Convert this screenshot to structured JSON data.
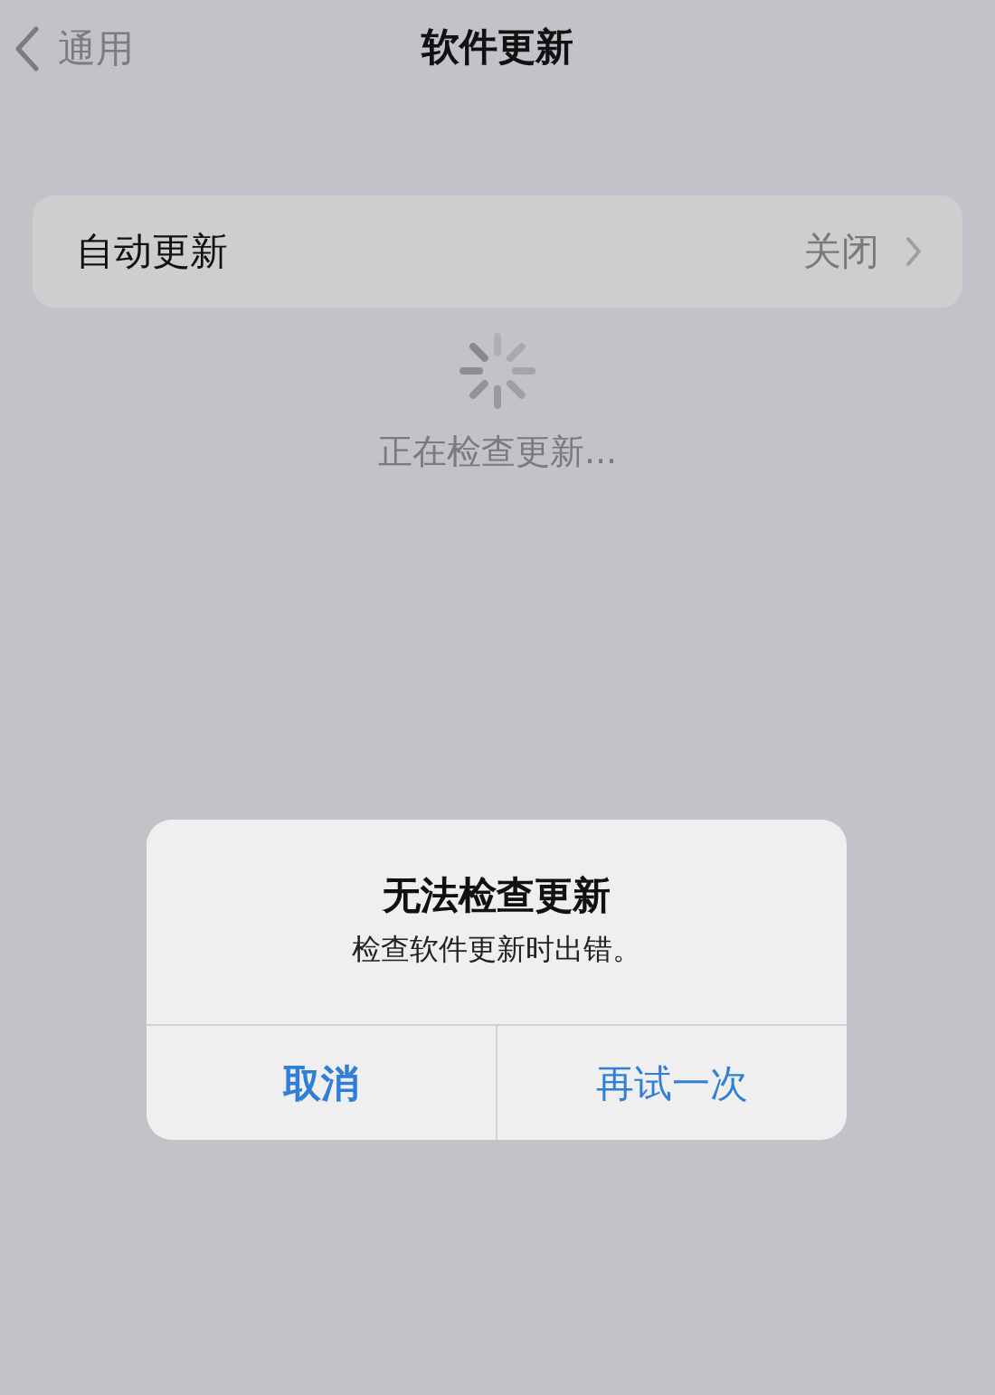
{
  "nav": {
    "back_label": "通用",
    "title": "软件更新"
  },
  "settings": [
    {
      "label": "自动更新",
      "value": "关闭"
    }
  ],
  "status": {
    "text": "正在检查更新..."
  },
  "alert": {
    "title": "无法检查更新",
    "message": "检查软件更新时出错。",
    "buttons": [
      {
        "label": "取消",
        "preferred": true
      },
      {
        "label": "再试一次",
        "preferred": false
      }
    ]
  }
}
